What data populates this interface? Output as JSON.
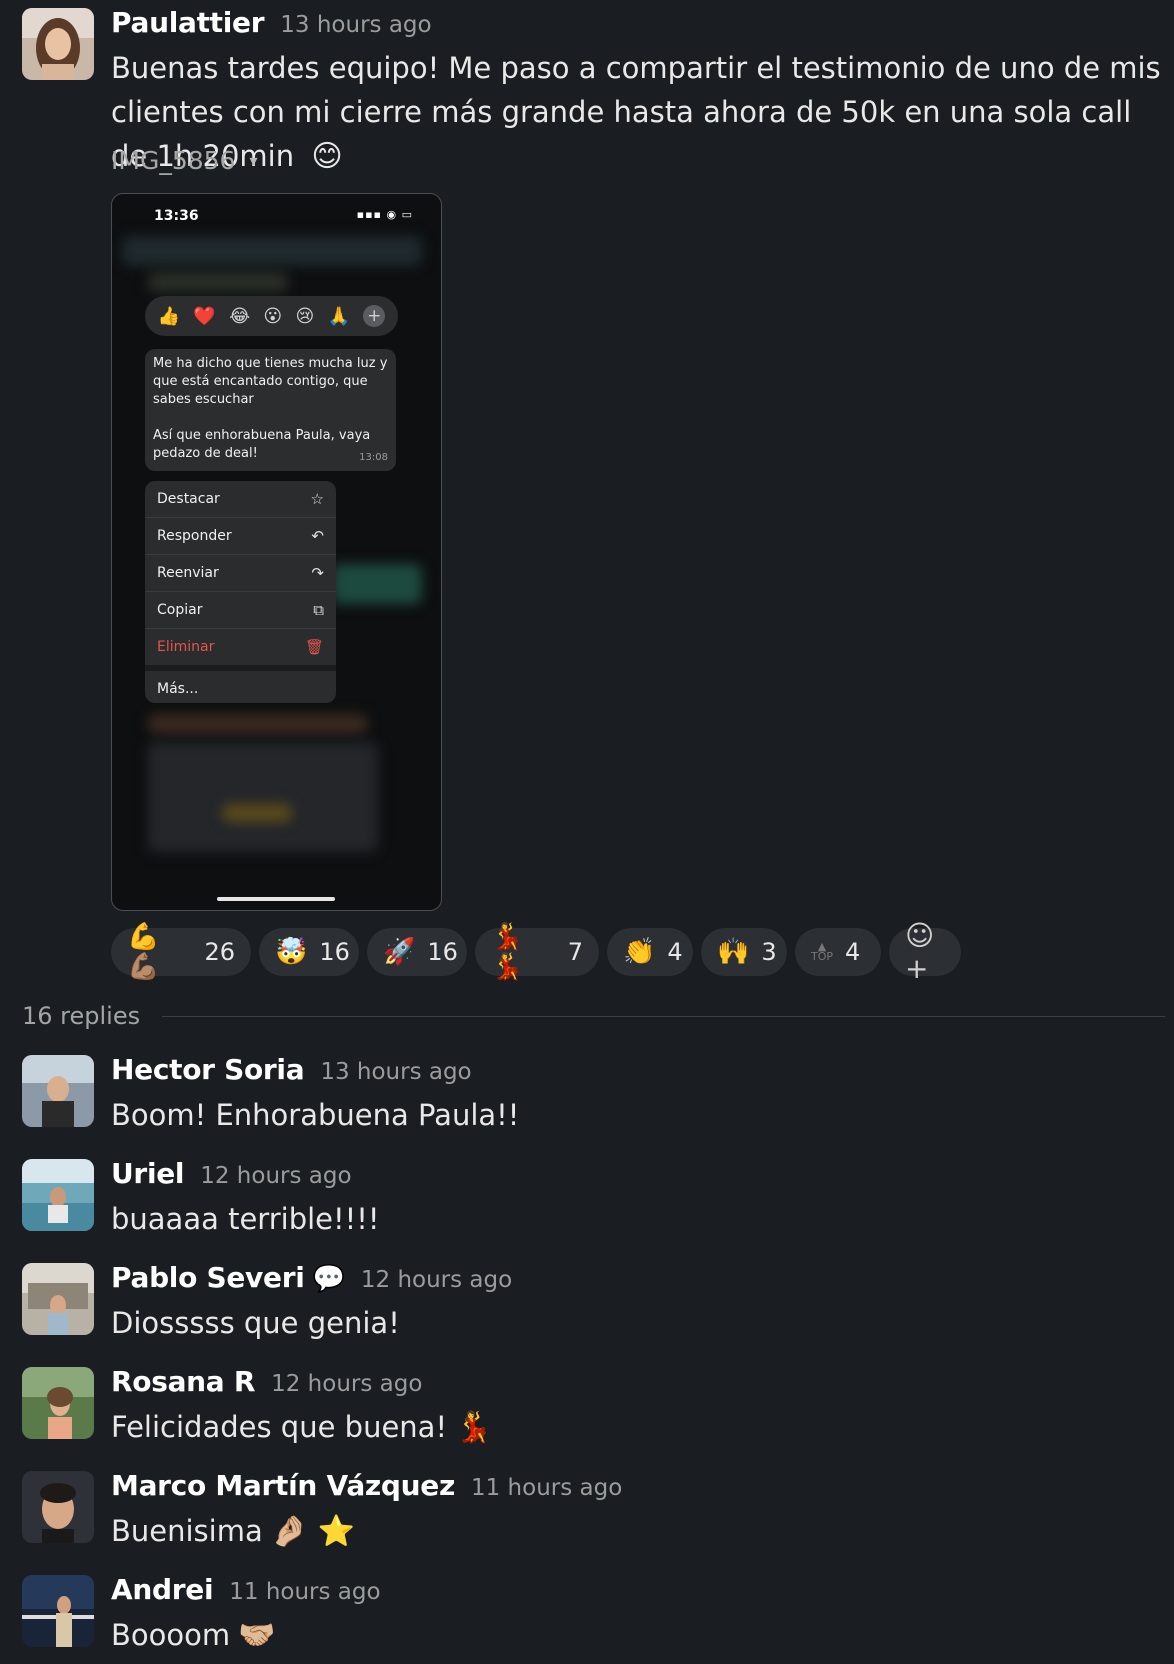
{
  "post": {
    "author": "Paulattier",
    "time": "13 hours ago",
    "text": "Buenas tardes equipo! Me paso a compartir el testimonio de uno de mis clientes con mi cierre más grande hasta ahora de 50k en una sola call de 1h 20min",
    "text_emoji": "😊",
    "attachment_name": "IMG_5856",
    "attachment_caret": "▾",
    "screenshot": {
      "status_time": "13:36",
      "status_icons": "▪▪▪ ◉ ▭",
      "reactions": [
        "👍",
        "❤️",
        "😂",
        "😮",
        "😢",
        "🙏"
      ],
      "react_more": "+",
      "message_text": "Me ha dicho que tienes mucha luz y que está encantado contigo, que sabes escuchar\n\nAsí que enhorabuena Paula, vaya pedazo de deal!",
      "message_time": "13:08",
      "menu": [
        {
          "label": "Destacar",
          "icon": "☆"
        },
        {
          "label": "Responder",
          "icon": "↶"
        },
        {
          "label": "Reenviar",
          "icon": "↷"
        },
        {
          "label": "Copiar",
          "icon": "⧉"
        },
        {
          "label": "Eliminar",
          "icon": "🗑"
        }
      ],
      "menu_more": "Más..."
    }
  },
  "reactions": [
    {
      "emoji": "💪 💪🏽",
      "count": "26"
    },
    {
      "emoji": "🤯",
      "count": "16"
    },
    {
      "emoji": "🚀",
      "count": "16"
    },
    {
      "emoji": "💃 💃",
      "count": "7"
    },
    {
      "emoji": "👏",
      "count": "4"
    },
    {
      "emoji": "🙌",
      "count": "3"
    },
    {
      "emoji": "TOP",
      "count": "4"
    }
  ],
  "add_reaction_icon": "☺+",
  "replies_label": "16 replies",
  "replies": [
    {
      "author": "Hector Soria",
      "time": "13 hours ago",
      "text": "Boom! Enhorabuena Paula!!",
      "emoji": ""
    },
    {
      "author": "Uriel",
      "time": "12 hours ago",
      "text": "buaaaa terrible!!!!",
      "emoji": ""
    },
    {
      "author": "Pablo Severi",
      "time": "12 hours ago",
      "text": "Diosssss que genia!",
      "emoji": "",
      "status_icon": "💬"
    },
    {
      "author": "Rosana R",
      "time": "12 hours ago",
      "text": "Felicidades que buena!",
      "emoji": "💃"
    },
    {
      "author": "Marco Martín Vázquez",
      "time": "11 hours ago",
      "text": "Buenisima",
      "emoji": "🤌🏼 ⭐"
    },
    {
      "author": "Andrei",
      "time": "11 hours ago",
      "text": "Boooom",
      "emoji": "🤝🏼"
    }
  ]
}
